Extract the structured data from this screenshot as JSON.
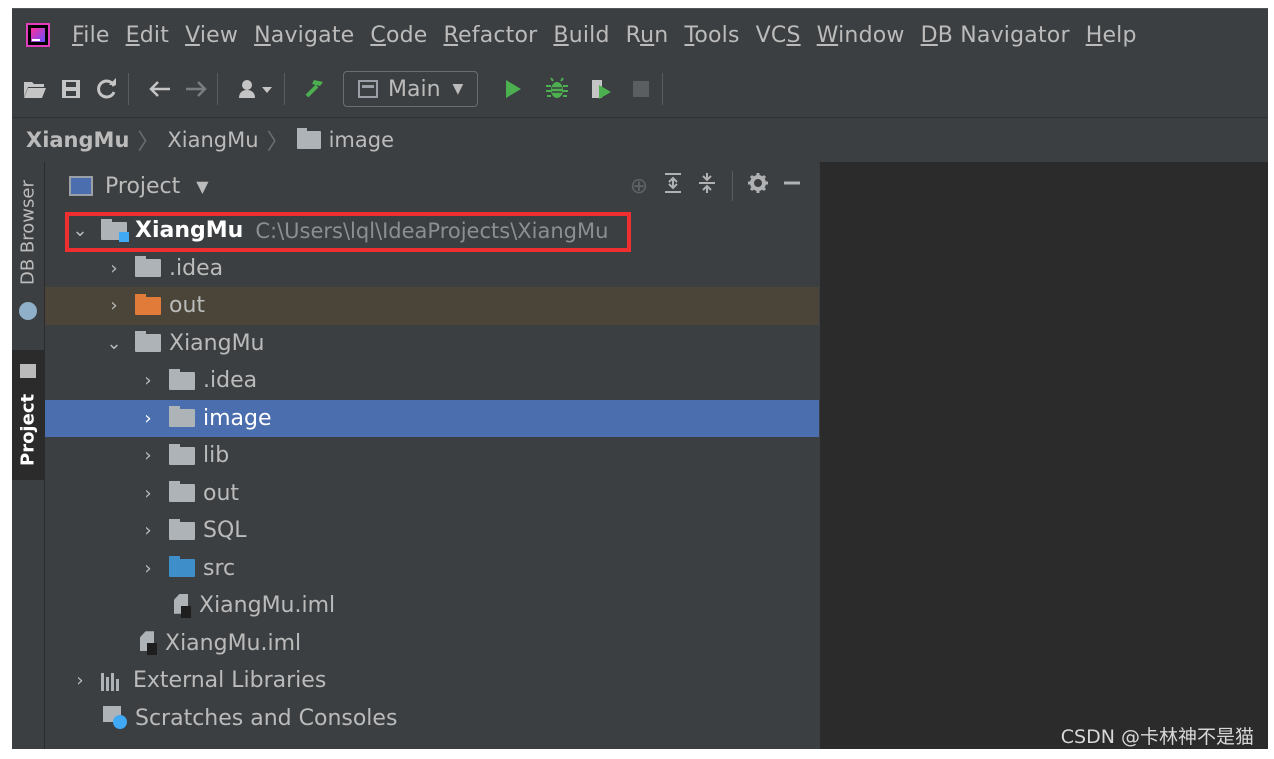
{
  "menu": {
    "items": [
      {
        "label": "File",
        "mnemonic": "F",
        "rest": "ile"
      },
      {
        "label": "Edit",
        "mnemonic": "E",
        "rest": "dit"
      },
      {
        "label": "View",
        "mnemonic": "V",
        "rest": "iew"
      },
      {
        "label": "Navigate",
        "mnemonic": "N",
        "rest": "avigate"
      },
      {
        "label": "Code",
        "mnemonic": "C",
        "rest": "ode"
      },
      {
        "label": "Refactor",
        "mnemonic": "R",
        "rest": "efactor"
      },
      {
        "label": "Build",
        "mnemonic": "B",
        "rest": "uild"
      },
      {
        "label": "Run",
        "pre": "R",
        "mnemonic": "u",
        "rest": "n"
      },
      {
        "label": "Tools",
        "mnemonic": "T",
        "rest": "ools"
      },
      {
        "label": "VCS",
        "pre": "VC",
        "mnemonic": "S",
        "rest": ""
      },
      {
        "label": "Window",
        "mnemonic": "W",
        "rest": "indow"
      },
      {
        "label": "DB Navigator",
        "mnemonic": "D",
        "rest": "B Navigator"
      },
      {
        "label": "Help",
        "mnemonic": "H",
        "rest": "elp"
      }
    ]
  },
  "toolbar": {
    "run_config": "Main"
  },
  "breadcrumb": {
    "project": "XiangMu",
    "module": "XiangMu",
    "folder": "image"
  },
  "tool_strip": {
    "db_browser": "DB Browser",
    "project": "Project"
  },
  "project_panel": {
    "title": "Project"
  },
  "tree": {
    "root": {
      "name": "XiangMu",
      "path": "C:\\Users\\lql\\IdeaProjects\\XiangMu"
    },
    "idea": ".idea",
    "out": "out",
    "module": "XiangMu",
    "module_idea": ".idea",
    "image": "image",
    "lib": "lib",
    "module_out": "out",
    "sql": "SQL",
    "src": "src",
    "module_iml": "XiangMu.iml",
    "root_iml": "XiangMu.iml",
    "external_libraries": "External Libraries",
    "scratches": "Scratches and Consoles"
  },
  "watermark": "CSDN @卡林神不是猫",
  "colors": {
    "selection": "#4b6eaf",
    "highlight_border": "#ef2f2f",
    "run_green": "#4caf50"
  }
}
